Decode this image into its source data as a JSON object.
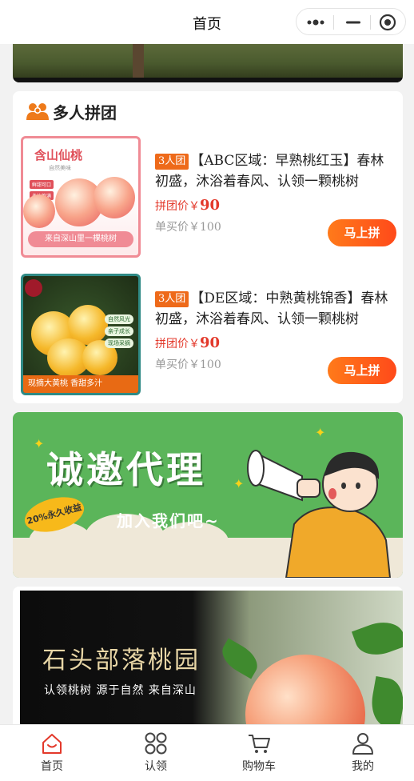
{
  "nav": {
    "title": "首页"
  },
  "group_section": {
    "title": "多人拼团"
  },
  "products": [
    {
      "image_title": "含山仙桃",
      "image_subtitle": "自然美味",
      "image_tags": [
        "鲜甜可口",
        "多汁饱满"
      ],
      "image_banner": "来自深山里一棵桃树",
      "badge": "3人团",
      "name": "【ABC区域：早熟桃红玉】春林初盛，沐浴着春风、认领一颗桃树",
      "group_price_label": "拼团价￥",
      "group_price": "90",
      "single_price_label": "单买价￥",
      "single_price": "100",
      "button": "马上拼"
    },
    {
      "image_chips": [
        "自然风光",
        "亲子成长",
        "现场采摘"
      ],
      "image_banner": "现摘大黄桃 香甜多汁",
      "badge": "3人团",
      "name": "【DE区域：中熟黄桃锦香】春林初盛，沐浴着春风、认领一颗桃树",
      "group_price_label": "拼团价￥",
      "group_price": "90",
      "single_price_label": "单买价￥",
      "single_price": "100",
      "button": "马上拼"
    }
  ],
  "agent_banner": {
    "headline": "诚邀代理",
    "subline": "加入我们吧~",
    "seal": "20%永久收益"
  },
  "orchard_banner": {
    "title": "石头部落桃园",
    "subtitle": "认领桃树 源于自然 来自深山"
  },
  "tabbar": [
    {
      "label": "首页",
      "icon": "home-icon",
      "active": true
    },
    {
      "label": "认领",
      "icon": "grid-icon",
      "active": false
    },
    {
      "label": "购物车",
      "icon": "cart-icon",
      "active": false
    },
    {
      "label": "我的",
      "icon": "user-icon",
      "active": false
    }
  ],
  "colors": {
    "accent": "#ff5a1a",
    "active_tab": "#e3392b",
    "agent_green": "#5bb55a"
  }
}
